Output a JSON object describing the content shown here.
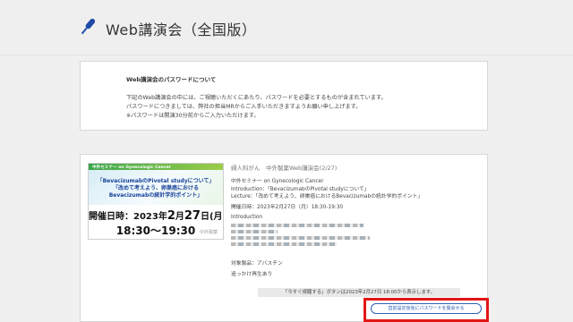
{
  "header": {
    "title": "Web講演会（全国版）",
    "icon": "microphone-icon"
  },
  "notice": {
    "heading": "Web講演会のパスワードについて",
    "lines": [
      "下記のWeb講演会の中には、ご視聴いただくにあたり、パスワードを必要とするものが含まれています。",
      "パスワードにつきましては、弊社の担当MRからご入手いただきますようお願い申し上げます。",
      "※パスワードは開演30分前からご入力いただけます。"
    ]
  },
  "event": {
    "banner": {
      "seminar": "中外セミナー on Gynecologic Cancer",
      "t1": "「BevacizumabのPivotal studyについて」",
      "t2": "「改めて考えよう、卵巣癌における",
      "t3": "Bevacizumabの統計学的ポイント」",
      "date_prefix": "開催日時：2023年",
      "date_big": "2",
      "date_mid": "月",
      "date_day": "27",
      "date_suffix": "日(月)",
      "time": "18:30～19:30",
      "logo": "中外製薬"
    },
    "category": "婦人科がん　中外製薬Web講演会(2/27)",
    "title": "中外セミナー on Gynecologic Cancer",
    "intro": "Introduction：「BevacizumabのPivotal studyについて」",
    "lecture": "Lecture：「改めて考えよう、卵巣癌におけるBevacizumabの統計学的ポイント」",
    "datetime": "開催日時：2023年2月27日（月）18:30-19:30",
    "intro_label": "Introduction",
    "product": "対象製品：アバスチン",
    "replay": "追っかけ再生あり",
    "notice_bar": "「今すぐ視聴する」ボタンは2023年2月27日 18:00から表示します。",
    "password_button": "直前設定後後にパスワードを聞会せる"
  }
}
